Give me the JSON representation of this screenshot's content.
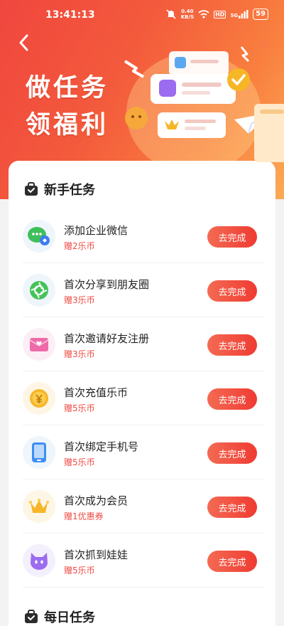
{
  "status_bar": {
    "time": "13:41:13",
    "net_speed_value": "0.40",
    "net_speed_unit": "KB/S",
    "signal_label": "5G",
    "hd_label": "HD",
    "battery": "59"
  },
  "hero": {
    "title_line1": "做任务",
    "title_line2": "领福利"
  },
  "sections": {
    "newbie": {
      "title": "新手任务"
    },
    "daily": {
      "title": "每日任务"
    }
  },
  "tasks": [
    {
      "title": "添加企业微信",
      "reward": "赠2乐币",
      "button": "去完成",
      "icon": "wechat-work-icon"
    },
    {
      "title": "首次分享到朋友圈",
      "reward": "赠3乐币",
      "button": "去完成",
      "icon": "moments-icon"
    },
    {
      "title": "首次邀请好友注册",
      "reward": "赠3乐币",
      "button": "去完成",
      "icon": "invite-letter-icon"
    },
    {
      "title": "首次充值乐币",
      "reward": "赠5乐币",
      "button": "去完成",
      "icon": "coin-icon"
    },
    {
      "title": "首次绑定手机号",
      "reward": "赠5乐币",
      "button": "去完成",
      "icon": "phone-icon"
    },
    {
      "title": "首次成为会员",
      "reward": "赠1优惠券",
      "button": "去完成",
      "icon": "crown-icon"
    },
    {
      "title": "首次抓到娃娃",
      "reward": "赠5乐币",
      "button": "去完成",
      "icon": "cat-doll-icon"
    }
  ],
  "colors": {
    "accent": "#ef3b33",
    "reward_text": "#ef4a43",
    "hero_gradient_start": "#f0463e",
    "hero_gradient_end": "#fbaa55"
  }
}
